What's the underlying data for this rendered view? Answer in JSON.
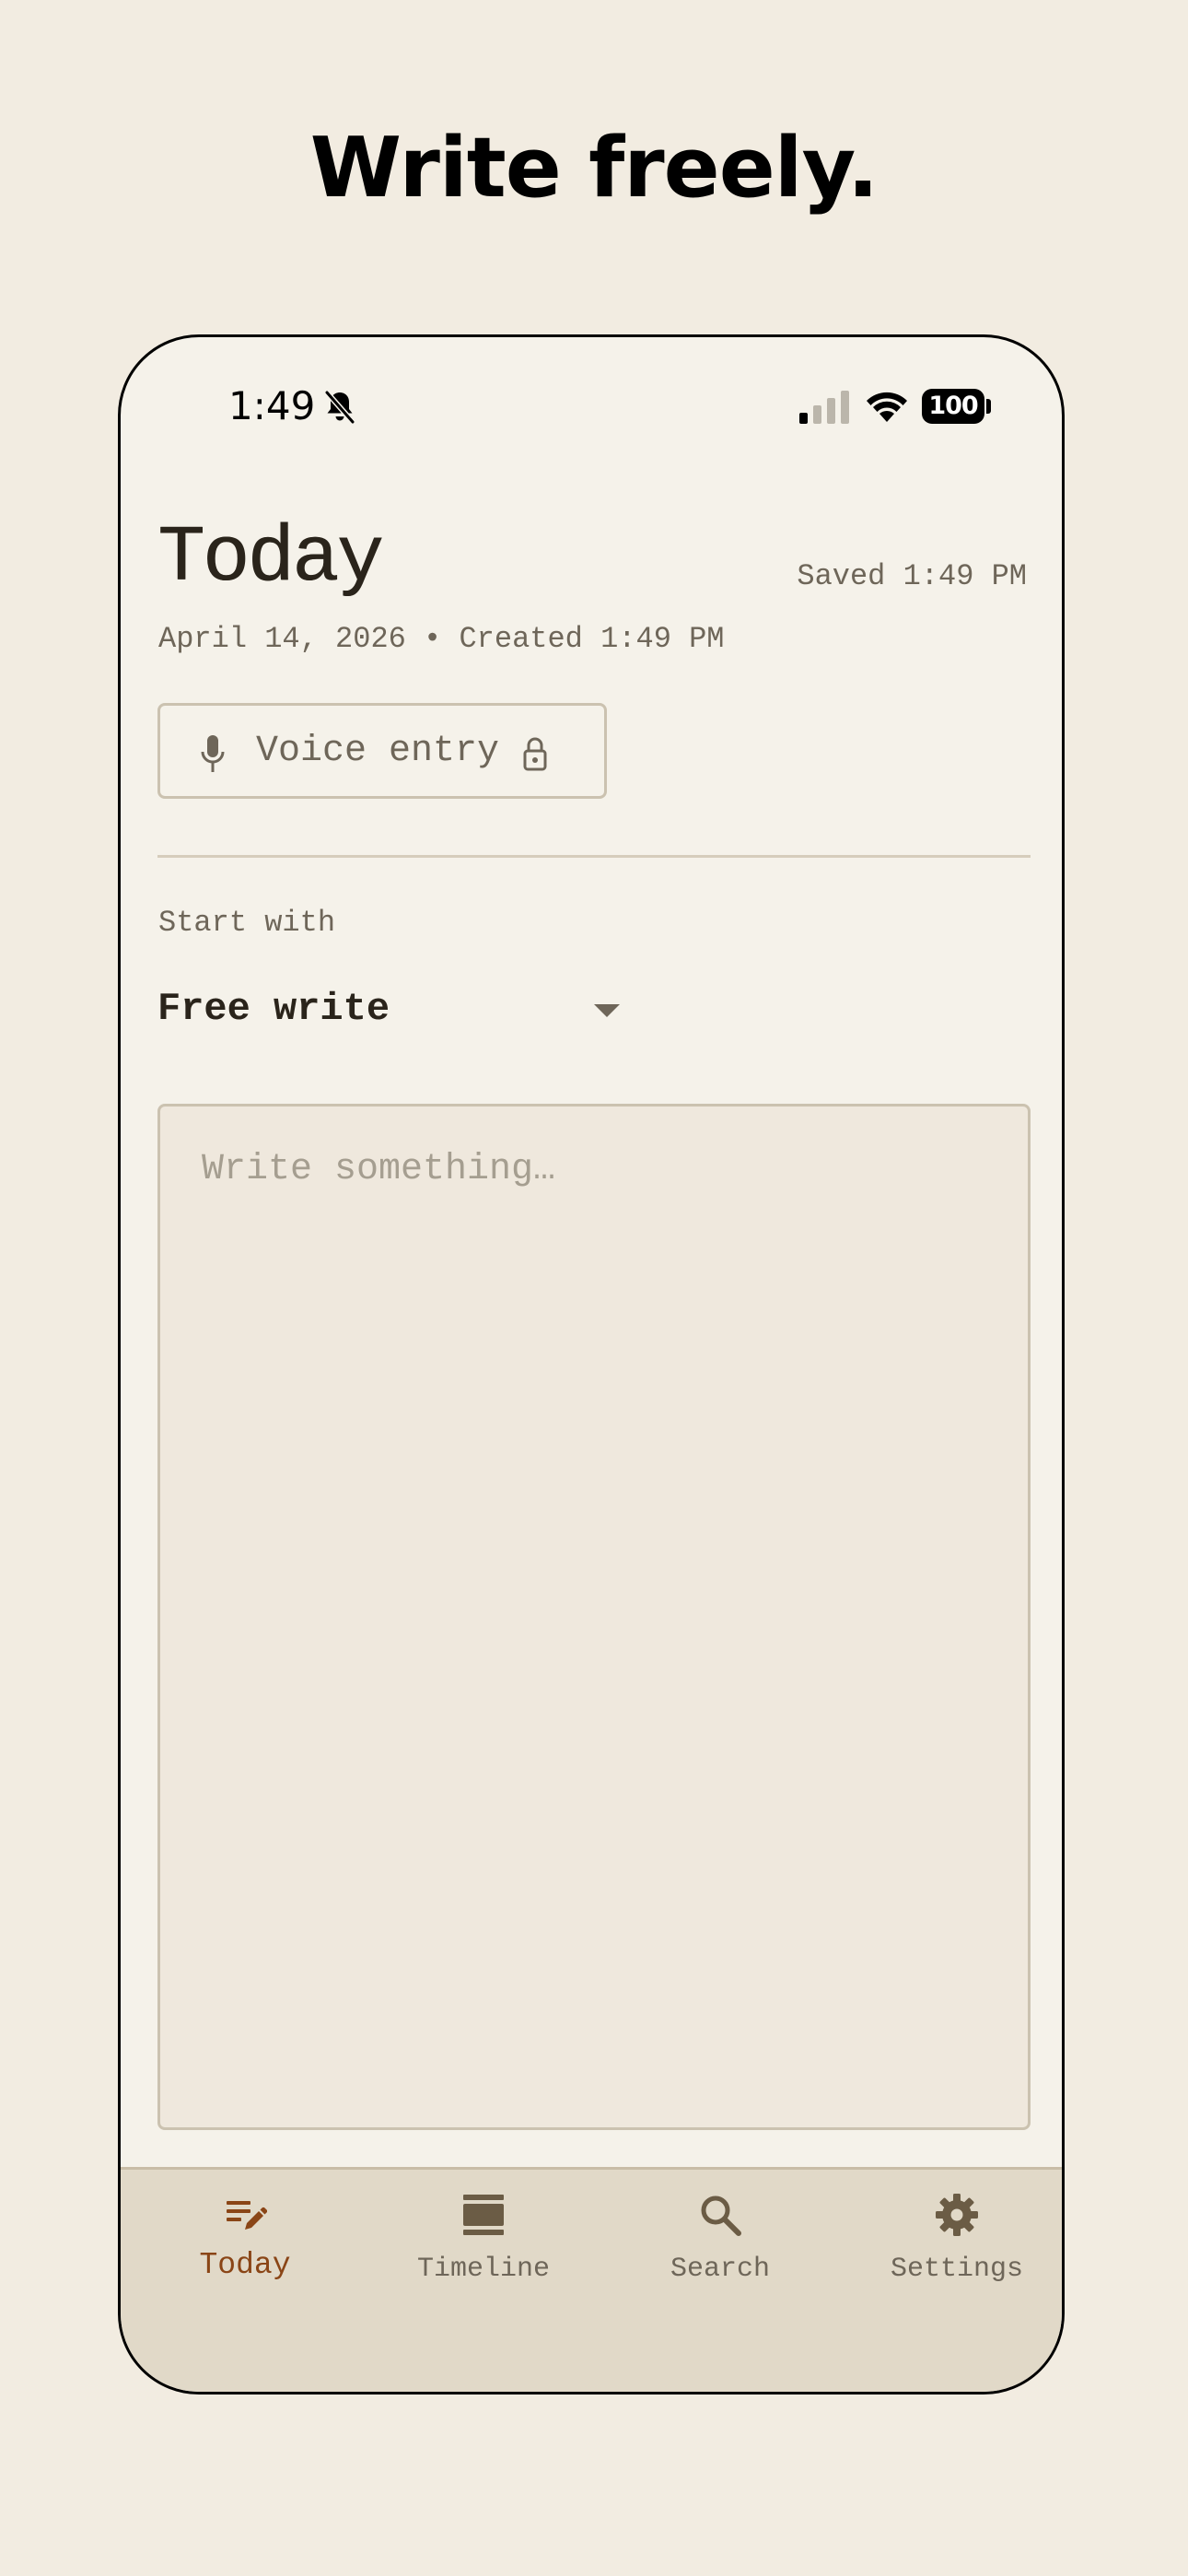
{
  "headline": "Write freely.",
  "status_bar": {
    "time": "1:49",
    "battery": "100"
  },
  "header": {
    "title": "Today",
    "saved_status": "Saved 1:49 PM",
    "meta": "April 14, 2026 • Created 1:49 PM"
  },
  "voice_entry": {
    "label": "Voice entry"
  },
  "start_with": {
    "label": "Start with",
    "selected": "Free write"
  },
  "editor": {
    "placeholder": "Write something…",
    "value": ""
  },
  "nav": {
    "items": [
      {
        "label": "Today",
        "icon": "edit-note-icon",
        "active": true
      },
      {
        "label": "Timeline",
        "icon": "timeline-icon",
        "active": false
      },
      {
        "label": "Search",
        "icon": "search-icon",
        "active": false
      },
      {
        "label": "Settings",
        "icon": "gear-icon",
        "active": false
      }
    ]
  },
  "colors": {
    "background": "#f2ece1",
    "phone_surface": "#f5f2ea",
    "text_primary": "#2a241b",
    "text_muted": "#6e6659",
    "accent_active": "#8a4516",
    "nav_background": "#e1d9c8",
    "editor_background": "#efe8dd"
  }
}
